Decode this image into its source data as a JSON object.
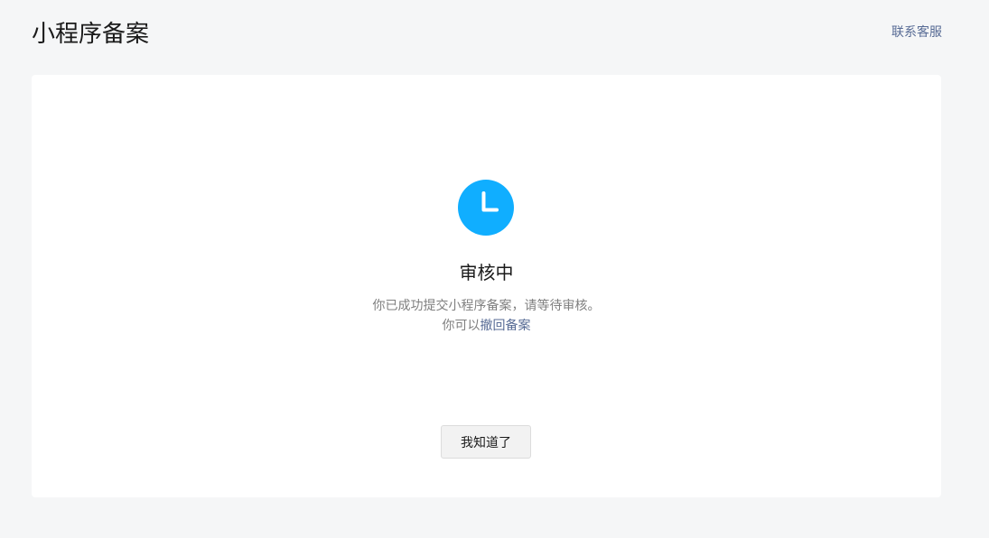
{
  "header": {
    "title": "小程序备案",
    "contact_label": "联系客服"
  },
  "status": {
    "icon": "clock-icon",
    "icon_color": "#10aeff",
    "title": "审核中",
    "description": "你已成功提交小程序备案，请等待审核。",
    "withdraw_prefix": "你可以",
    "withdraw_link": "撤回备案"
  },
  "actions": {
    "ok_label": "我知道了"
  }
}
